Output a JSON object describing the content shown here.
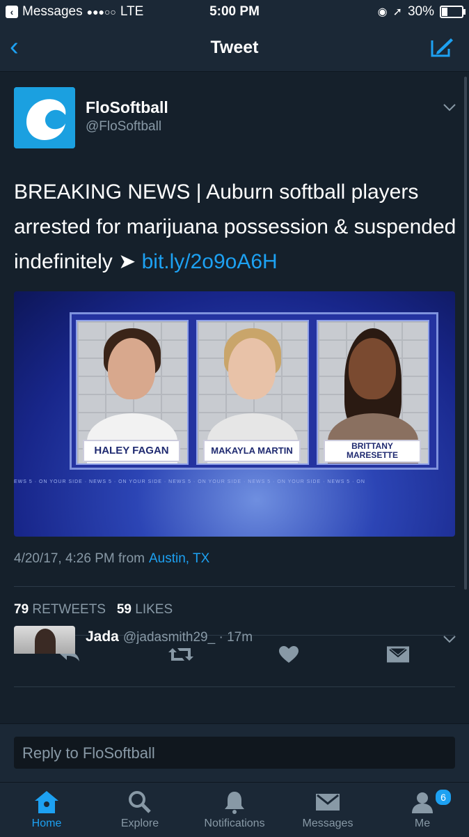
{
  "status_bar": {
    "carrier": "Messages",
    "signal": "●●●○○",
    "network": "LTE",
    "time": "5:00 PM",
    "battery": "30%",
    "battery_level": 0.3
  },
  "nav": {
    "title": "Tweet"
  },
  "tweet": {
    "author_name": "FloSoftball",
    "author_handle": "@FloSoftball",
    "text": "BREAKING NEWS | Auburn softball players arrested for marijuana possession & suspended indefinitely",
    "arrow": "➤",
    "link": "bit.ly/2o9oA6H",
    "media": {
      "names": [
        "HALEY FAGAN",
        "MAKAYLA MARTIN",
        "BRITTANY\nMARESETTE"
      ],
      "ticker": "EWS 5 · ON YOUR SIDE · NEWS 5 · ON YOUR SIDE · NEWS 5 · ON YOUR SIDE · NEWS 5 · ON YOUR SIDE · NEWS 5 · ON"
    },
    "timestamp": "4/20/17, 4:26 PM from",
    "location": "Austin, TX",
    "retweets_count": "79",
    "retweets_label": "RETWEETS",
    "likes_count": "59",
    "likes_label": "LIKES"
  },
  "reply_preview": {
    "name": "Jada",
    "handle": "@jadasmith29_ · 17m"
  },
  "composer": {
    "placeholder": "Reply to FloSoftball"
  },
  "tabs": [
    {
      "label": "Home",
      "icon": "home-icon",
      "active": true
    },
    {
      "label": "Explore",
      "icon": "search-icon"
    },
    {
      "label": "Notifications",
      "icon": "bell-icon"
    },
    {
      "label": "Messages",
      "icon": "envelope-icon"
    },
    {
      "label": "Me",
      "icon": "person-icon",
      "badge": "6"
    }
  ],
  "colors": {
    "accent": "#1da1f2",
    "background": "#15202b",
    "bar": "#1b2836",
    "muted": "#8899a6"
  }
}
